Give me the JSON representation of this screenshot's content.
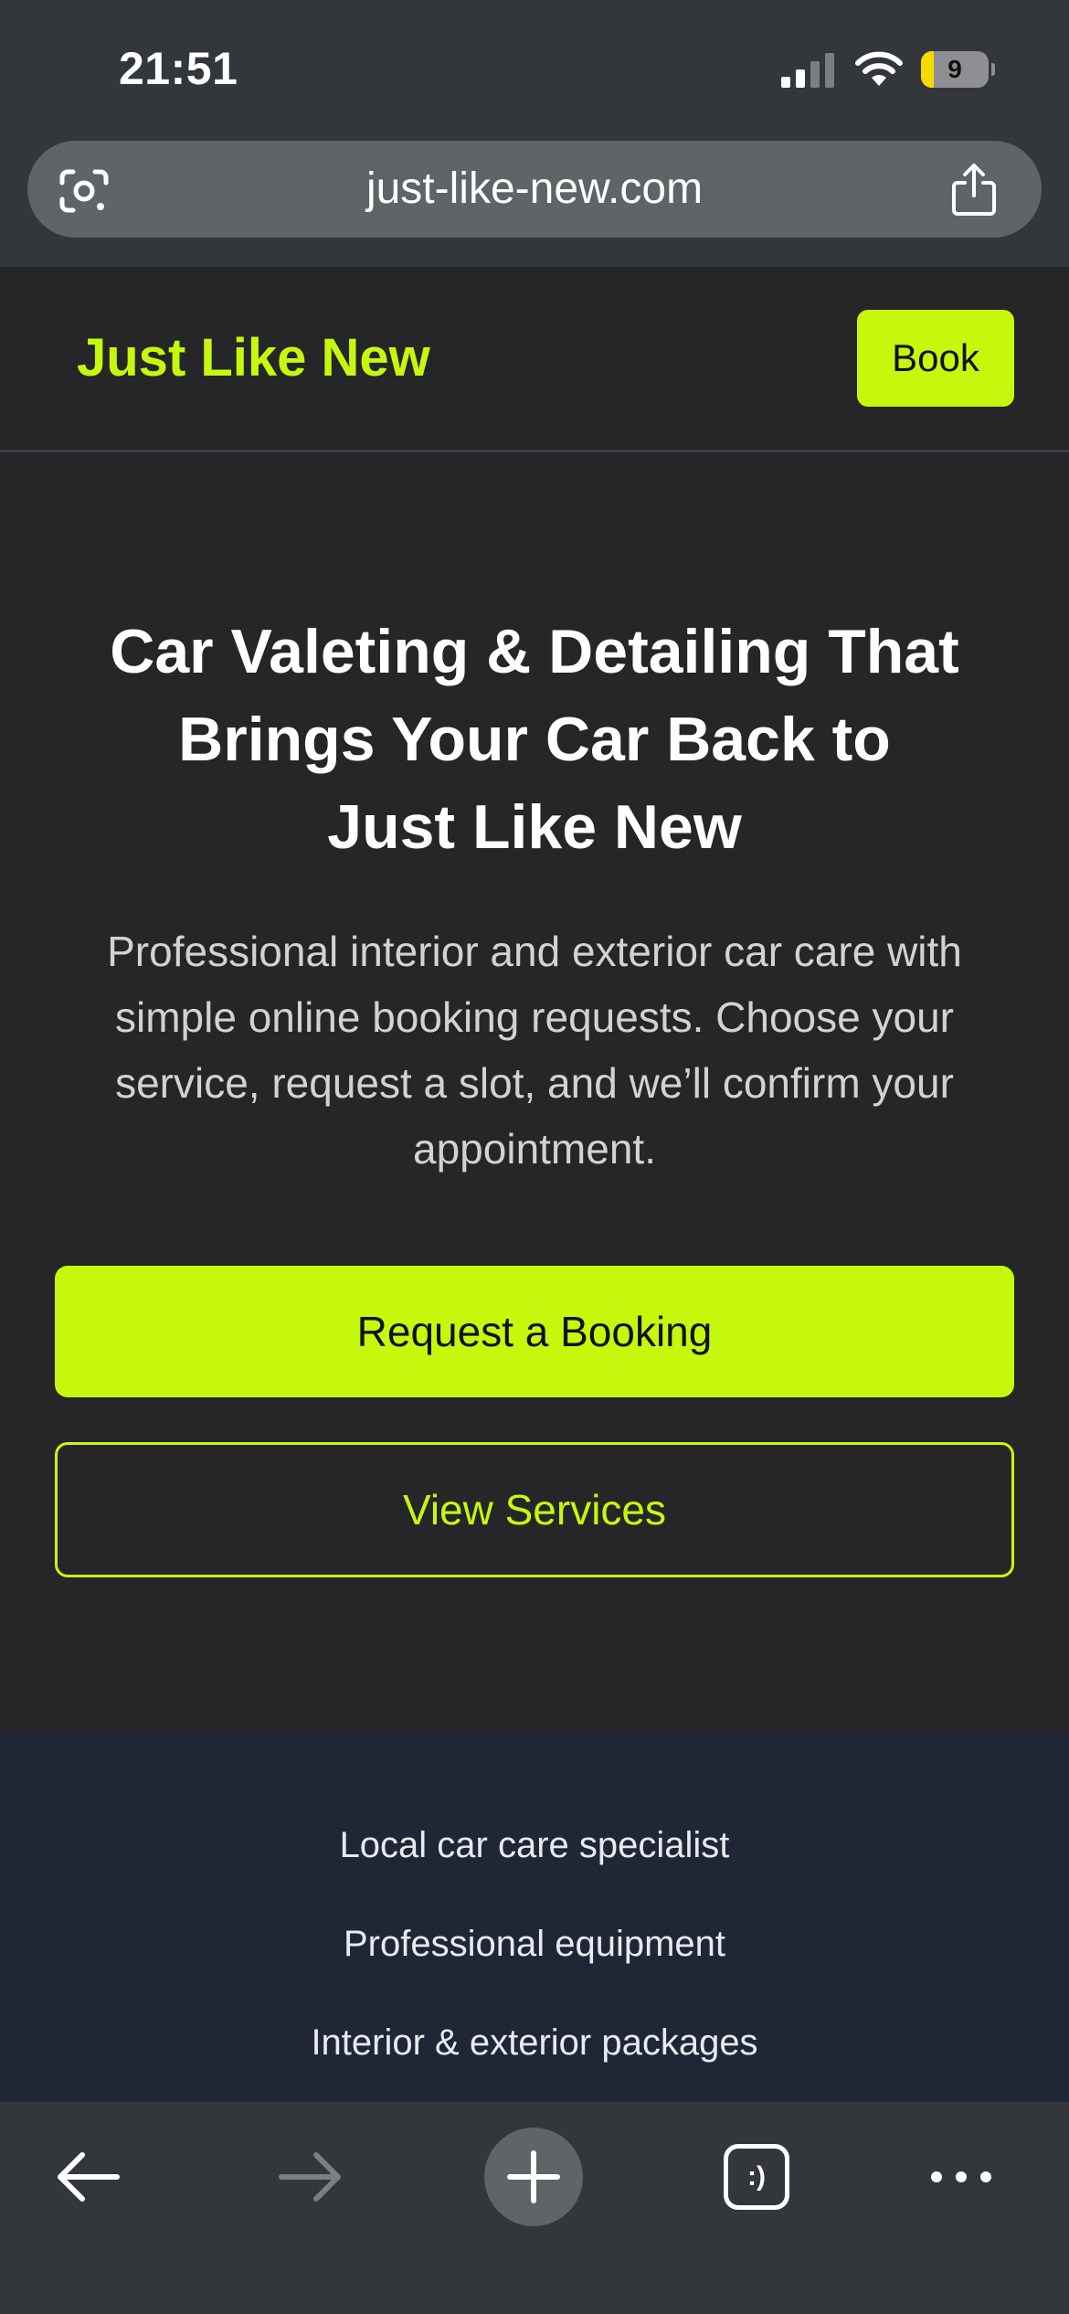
{
  "status_bar": {
    "time": "21:51",
    "battery_level": "9",
    "battery_fraction": 0.09,
    "charging": true,
    "icons": [
      "signal-icon",
      "wifi-icon",
      "battery-icon"
    ]
  },
  "browser": {
    "url": "just-like-new.com",
    "icons": {
      "lens": "lens-icon",
      "share": "share-icon"
    },
    "toolbar": {
      "tab_switcher_label": ":)",
      "icons": [
        "back-arrow-icon",
        "forward-arrow-icon",
        "plus-icon",
        "tab-switcher-icon",
        "more-icon"
      ]
    }
  },
  "header": {
    "brand": "Just Like New",
    "book_label": "Book"
  },
  "hero": {
    "title_lines": [
      "Car Valeting & Detailing That",
      "Brings Your Car Back to",
      "Just Like New"
    ],
    "subtitle_lines": [
      "Professional interior and exterior car care with",
      "simple online booking requests. Choose your",
      "service, request a slot, and we’ll confirm your",
      "appointment."
    ],
    "primary_cta": "Request a Booking",
    "secondary_cta": "View Services"
  },
  "features": [
    "Local car care specialist",
    "Professional equipment",
    "Interior & exterior packages"
  ],
  "colors": {
    "accent": "#c6f80e",
    "background": "#262628",
    "features_bg": "#1f2737",
    "chrome": "#33363a"
  }
}
